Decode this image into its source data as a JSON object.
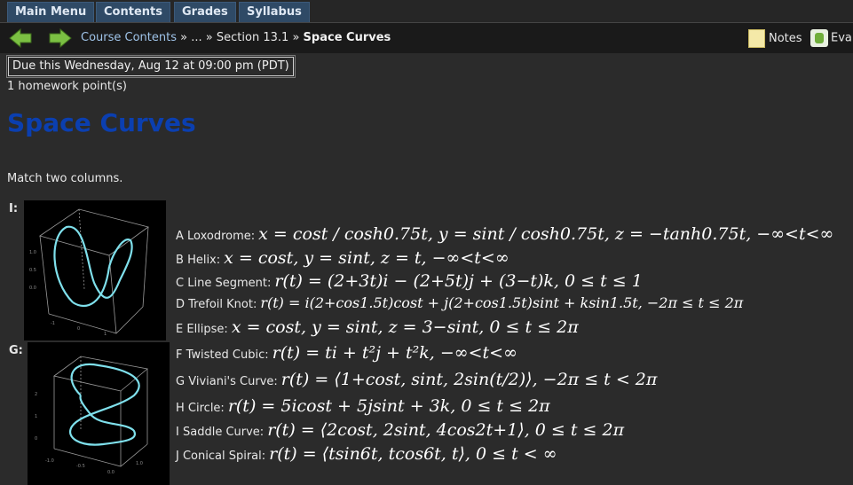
{
  "menu": {
    "tabs": [
      "Main Menu",
      "Contents",
      "Grades",
      "Syllabus"
    ]
  },
  "nav": {
    "crumb_link": "Course Contents",
    "crumb_sep1": "»",
    "crumb_mid": "...",
    "crumb_sep2": "»",
    "crumb_section": "Section 13.1",
    "crumb_sep3": "»",
    "crumb_current": "Space Curves",
    "notes_label": "Notes",
    "eval_label": "Eva"
  },
  "assignment": {
    "due": "Due this Wednesday, Aug 12 at 09:00 pm (PDT)",
    "points": "1 homework point(s)",
    "title": "Space Curves",
    "instruction": "Match two columns."
  },
  "questions": [
    {
      "label": "I:"
    },
    {
      "label": "G:"
    }
  ],
  "options": [
    {
      "letter": "A",
      "name": "Loxodrome:",
      "formula": "x = cost / cosh0.75t, y = sint / cosh0.75t, z = −tanh0.75t, −∞<t<∞"
    },
    {
      "letter": "B",
      "name": "Helix:",
      "formula": "x = cost, y = sint, z = t, −∞<t<∞"
    },
    {
      "letter": "C",
      "name": "Line Segment:",
      "formula": "r(t) = (2+3t)i − (2+5t)j + (3−t)k, 0 ≤ t ≤ 1"
    },
    {
      "letter": "D",
      "name": "Trefoil Knot:",
      "formula": "r(t) = i(2+cos1.5t)cost + j(2+cos1.5t)sint + ksin1.5t, −2π ≤ t ≤ 2π"
    },
    {
      "letter": "E",
      "name": "Ellipse:",
      "formula": "x = cost, y = sint, z = 3−sint, 0 ≤ t ≤ 2π"
    },
    {
      "letter": "F",
      "name": "Twisted Cubic:",
      "formula": "r(t) = ti + t²j + t²k, −∞<t<∞"
    },
    {
      "letter": "G",
      "name": "Viviani's Curve:",
      "formula": "r(t) = ⟨1+cost, sint, 2sin(t/2)⟩, −2π ≤ t < 2π"
    },
    {
      "letter": "H",
      "name": "Circle:",
      "formula": "r(t) = 5icost + 5jsint + 3k, 0 ≤ t ≤ 2π"
    },
    {
      "letter": "I",
      "name": "Saddle Curve:",
      "formula": "r(t) = ⟨2cost, 2sint, 4cos2t+1⟩, 0 ≤ t ≤ 2π"
    },
    {
      "letter": "J",
      "name": "Conical Spiral:",
      "formula": "r(t) = ⟨tsin6t, tcos6t, t⟩, 0 ≤ t < ∞"
    }
  ],
  "colors": {
    "title": "#0b3fb0",
    "link": "#9fc3e8",
    "curve": "#7fe0ec",
    "arrow": "#7bc043"
  }
}
